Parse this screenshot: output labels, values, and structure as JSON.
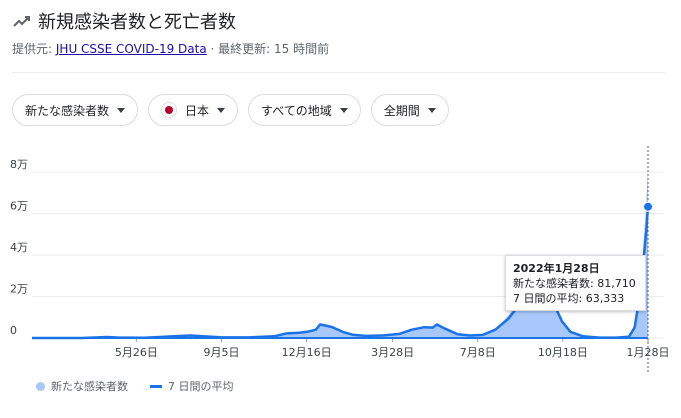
{
  "header": {
    "title": "新規感染者数と死亡者数",
    "source_prefix": "提供元:",
    "source_link": "JHU CSSE COVID-19 Data",
    "updated": "· 最終更新: 15 時間前"
  },
  "filters": {
    "metric": "新たな感染者数",
    "country": "日本",
    "region": "すべての地域",
    "period": "全期間"
  },
  "tooltip": {
    "date": "2022年1月28日",
    "new_cases": "新たな感染者数: 81,710",
    "avg": "7 日間の平均: 63,333"
  },
  "legend": {
    "bars": "新たな感染者数",
    "line": "7 日間の平均"
  },
  "colors": {
    "line": "#1a73e8",
    "bars": "#a8c7fa",
    "grid": "#e8eaed"
  },
  "chart_data": {
    "type": "area",
    "title": "新規感染者数と死亡者数",
    "y_ticks": [
      {
        "value": 0,
        "label": "0"
      },
      {
        "value": 20000,
        "label": "2万"
      },
      {
        "value": 40000,
        "label": "4万"
      },
      {
        "value": 60000,
        "label": "6万"
      },
      {
        "value": 80000,
        "label": "8万"
      }
    ],
    "x_ticks": [
      {
        "day": 125,
        "label": "5月26日"
      },
      {
        "day": 227,
        "label": "9月5日"
      },
      {
        "day": 329,
        "label": "12月16日"
      },
      {
        "day": 432,
        "label": "3月28日"
      },
      {
        "day": 534,
        "label": "7月8日"
      },
      {
        "day": 636,
        "label": "10月18日"
      },
      {
        "day": 738,
        "label": "1月28日"
      }
    ],
    "x_range_days": [
      0,
      738
    ],
    "ylim": [
      0,
      85000
    ],
    "series": [
      {
        "name": "7 日間の平均",
        "points": [
          [
            0,
            0
          ],
          [
            60,
            0
          ],
          [
            90,
            500
          ],
          [
            105,
            200
          ],
          [
            135,
            100
          ],
          [
            170,
            800
          ],
          [
            190,
            1200
          ],
          [
            205,
            800
          ],
          [
            225,
            400
          ],
          [
            260,
            300
          ],
          [
            290,
            800
          ],
          [
            305,
            2200
          ],
          [
            320,
            2500
          ],
          [
            330,
            3000
          ],
          [
            340,
            4000
          ],
          [
            345,
            6500
          ],
          [
            352,
            6000
          ],
          [
            360,
            5200
          ],
          [
            372,
            3000
          ],
          [
            385,
            1500
          ],
          [
            400,
            1000
          ],
          [
            420,
            1200
          ],
          [
            440,
            2000
          ],
          [
            455,
            4000
          ],
          [
            470,
            5200
          ],
          [
            480,
            5000
          ],
          [
            485,
            6500
          ],
          [
            495,
            4500
          ],
          [
            510,
            1800
          ],
          [
            525,
            1200
          ],
          [
            540,
            1500
          ],
          [
            555,
            4000
          ],
          [
            570,
            9000
          ],
          [
            580,
            14000
          ],
          [
            590,
            18000
          ],
          [
            600,
            22000
          ],
          [
            610,
            23500
          ],
          [
            620,
            19500
          ],
          [
            628,
            14000
          ],
          [
            635,
            8000
          ],
          [
            645,
            3000
          ],
          [
            660,
            800
          ],
          [
            680,
            200
          ],
          [
            700,
            200
          ],
          [
            715,
            600
          ],
          [
            722,
            5000
          ],
          [
            728,
            20000
          ],
          [
            732,
            35000
          ],
          [
            736,
            52000
          ],
          [
            738,
            63333
          ]
        ]
      },
      {
        "name": "新たな感染者数",
        "points": [
          [
            0,
            0
          ],
          [
            60,
            0
          ],
          [
            90,
            600
          ],
          [
            105,
            250
          ],
          [
            135,
            150
          ],
          [
            170,
            900
          ],
          [
            190,
            1400
          ],
          [
            205,
            900
          ],
          [
            225,
            500
          ],
          [
            260,
            400
          ],
          [
            290,
            900
          ],
          [
            305,
            2500
          ],
          [
            320,
            2800
          ],
          [
            330,
            3400
          ],
          [
            340,
            4600
          ],
          [
            345,
            7200
          ],
          [
            352,
            6600
          ],
          [
            360,
            5800
          ],
          [
            372,
            3400
          ],
          [
            385,
            1800
          ],
          [
            400,
            1200
          ],
          [
            420,
            1400
          ],
          [
            440,
            2300
          ],
          [
            455,
            4500
          ],
          [
            470,
            5800
          ],
          [
            480,
            5600
          ],
          [
            485,
            7000
          ],
          [
            495,
            5000
          ],
          [
            510,
            2100
          ],
          [
            525,
            1400
          ],
          [
            540,
            1800
          ],
          [
            555,
            4600
          ],
          [
            570,
            10500
          ],
          [
            580,
            16000
          ],
          [
            590,
            20500
          ],
          [
            600,
            25000
          ],
          [
            610,
            25500
          ],
          [
            620,
            21000
          ],
          [
            628,
            15000
          ],
          [
            635,
            8800
          ],
          [
            645,
            3400
          ],
          [
            660,
            1000
          ],
          [
            680,
            300
          ],
          [
            700,
            300
          ],
          [
            715,
            800
          ],
          [
            722,
            6200
          ],
          [
            728,
            24000
          ],
          [
            732,
            42000
          ],
          [
            736,
            66000
          ],
          [
            738,
            81710
          ]
        ]
      }
    ]
  }
}
